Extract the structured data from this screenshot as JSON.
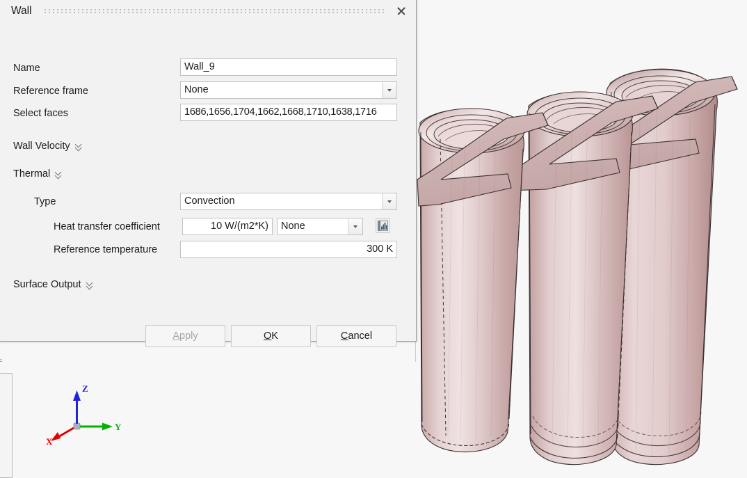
{
  "dialog": {
    "title": "Wall",
    "close_icon": "close-icon",
    "fields": {
      "name": {
        "label": "Name",
        "value": "Wall_9"
      },
      "reference_frame": {
        "label": "Reference frame",
        "value": "None"
      },
      "select_faces": {
        "label": "Select faces",
        "value": "1686,1656,1704,1662,1668,1710,1638,1716"
      }
    },
    "groups": {
      "wall_velocity": {
        "label": "Wall Velocity",
        "expander_icon": "double-chevron-down-icon"
      },
      "thermal": {
        "label": "Thermal",
        "expander_icon": "double-chevron-down-icon"
      },
      "surface_output": {
        "label": "Surface Output",
        "expander_icon": "double-chevron-down-icon"
      }
    },
    "thermal": {
      "type": {
        "label": "Type",
        "value": "Convection"
      },
      "heat_transfer_coefficient": {
        "label": "Heat transfer coefficient",
        "value": "10 W/(m2*K)",
        "profile": "None",
        "table_icon": "chart-table-icon"
      },
      "reference_temperature": {
        "label": "Reference temperature",
        "value": "300 K"
      }
    },
    "buttons": {
      "apply": {
        "label": "Apply",
        "mnemonic": "A",
        "rest": "pply",
        "disabled": true
      },
      "ok": {
        "label": "OK",
        "mnemonic": "O",
        "rest": "K",
        "disabled": false
      },
      "cancel": {
        "label": "Cancel",
        "mnemonic": "C",
        "rest": "ancel",
        "disabled": false
      }
    }
  },
  "viewport": {
    "background_color": "#f8f7f7",
    "model_description": "Three cylindrical battery cells with Z-shaped busbar tabs",
    "model_color": "#d6bcbc",
    "axis_triad": {
      "z": {
        "label": "Z",
        "color": "#2323d8"
      },
      "y": {
        "label": "Y",
        "color": "#00b300"
      },
      "x": {
        "label": "X",
        "color": "#e00000"
      }
    }
  },
  "left_panel": {
    "clipped_label": "="
  }
}
